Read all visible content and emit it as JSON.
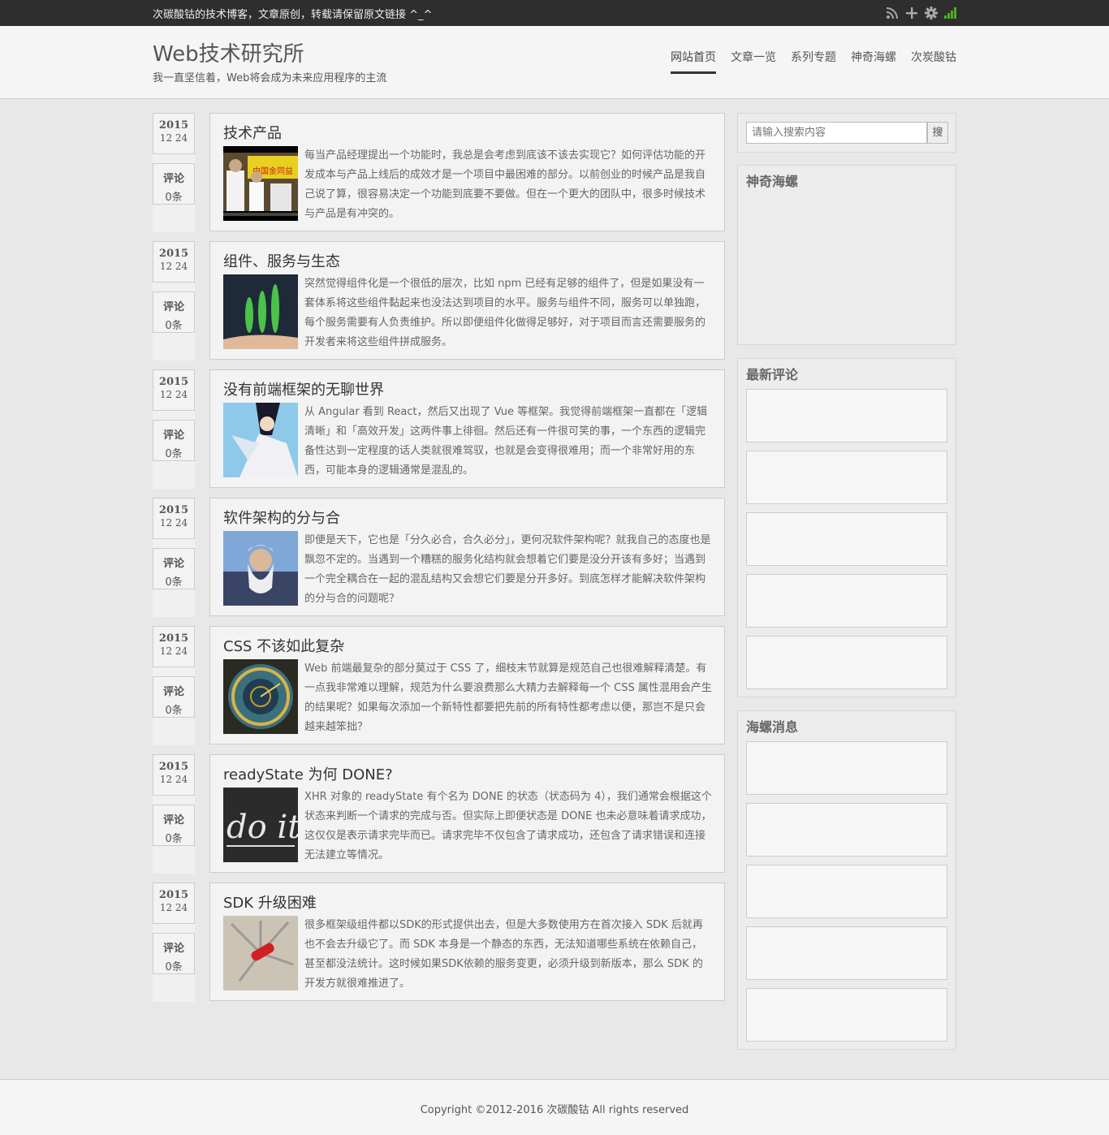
{
  "topbar": {
    "notice": "次碳酸钴的技术博客，文章原创，转载请保留原文链接 ^_^",
    "icons": [
      "rss-icon",
      "plus-icon",
      "gear-icon",
      "signal-icon"
    ],
    "signal_color": "#4caf1f"
  },
  "header": {
    "title": "Web技术研究所",
    "subtitle": "我一直坚信着，Web将会成为未来应用程序的主流",
    "nav": [
      "网站首页",
      "文章一览",
      "系列专题",
      "神奇海螺",
      "次炭酸钴"
    ]
  },
  "posts": [
    {
      "year": "2015",
      "md": "12 24",
      "comment_label": "评论",
      "comment_count": "0条",
      "title": "技术产品",
      "excerpt": "每当产品经理提出一个功能时，我总是会考虑到底该不该去实现它？如何评估功能的开发成本与产品上线后的成效才是一个项目中最困难的部分。以前创业的时候产品是我自己说了算，很容易决定一个功能到底要不要做。但在一个更大的团队中，很多时候技术与产品是有冲突的。",
      "thumb_text": "中国金同益"
    },
    {
      "year": "2015",
      "md": "12 24",
      "comment_label": "评论",
      "comment_count": "0条",
      "title": "组件、服务与生态",
      "excerpt": "突然觉得组件化是一个很低的层次，比如 npm 已经有足够的组件了，但是如果没有一套体系将这些组件黏起来也没法达到项目的水平。服务与组件不同，服务可以单独跑，每个服务需要有人负责维护。所以即便组件化做得足够好，对于项目而言还需要服务的开发者来将这些组件拼成服务。"
    },
    {
      "year": "2015",
      "md": "12 24",
      "comment_label": "评论",
      "comment_count": "0条",
      "title": "没有前端框架的无聊世界",
      "excerpt": "从 Angular 看到 React，然后又出现了 Vue 等框架。我觉得前端框架一直都在「逻辑清晰」和「高效开发」这两件事上徘徊。然后还有一件很可笑的事，一个东西的逻辑完备性达到一定程度的话人类就很难驾驭，也就是会变得很难用；而一个非常好用的东西，可能本身的逻辑通常是混乱的。"
    },
    {
      "year": "2015",
      "md": "12 24",
      "comment_label": "评论",
      "comment_count": "0条",
      "title": "软件架构的分与合",
      "excerpt": "即便是天下，它也是「分久必合，合久必分」，更何况软件架构呢？就我自己的态度也是飘忽不定的。当遇到一个糟糕的服务化结构就会想着它们要是没分开该有多好；当遇到一个完全耦合在一起的混乱结构又会想它们要是分开多好。到底怎样才能解决软件架构的分与合的问题呢？"
    },
    {
      "year": "2015",
      "md": "12 24",
      "comment_label": "评论",
      "comment_count": "0条",
      "title": "CSS 不该如此复杂",
      "excerpt": "Web 前端最复杂的部分莫过于 CSS 了，细枝末节就算是规范自己也很难解释清楚。有一点我非常难以理解，规范为什么要浪费那么大精力去解释每一个 CSS 属性混用会产生的结果呢？如果每次添加一个新特性都要把先前的所有特性都考虑以便，那岂不是只会越来越笨拙？"
    },
    {
      "year": "2015",
      "md": "12 24",
      "comment_label": "评论",
      "comment_count": "0条",
      "title": "readyState 为何 DONE?",
      "excerpt": "XHR 对象的 readyState 有个名为 DONE 的状态（状态码为 4），我们通常会根据这个状态来判断一个请求的完成与否。但实际上即便状态是 DONE 也未必意味着请求成功，这仅仅是表示请求完毕而已。请求完毕不仅包含了请求成功，还包含了请求错误和连接无法建立等情况。",
      "thumb_text": "do it"
    },
    {
      "year": "2015",
      "md": "12 24",
      "comment_label": "评论",
      "comment_count": "0条",
      "title": "SDK 升级困难",
      "excerpt": "很多框架级组件都以SDK的形式提供出去，但是大多数使用方在首次接入 SDK 后就再也不会去升级它了。而 SDK 本身是一个静态的东西，无法知道哪些系统在依赖自己，甚至都没法统计。这时候如果SDK依赖的服务变更，必须升级到新版本，那么 SDK 的开发方就很难推进了。"
    }
  ],
  "sidebar": {
    "search_placeholder": "请输入搜索内容",
    "search_button": "搜",
    "magic_conch_title": "神奇海螺",
    "recent_comments_title": "最新评论",
    "conch_messages_title": "海螺消息"
  },
  "footer": {
    "copyright": "Copyright ©2012-2016 次碳酸钴 All rights reserved"
  }
}
